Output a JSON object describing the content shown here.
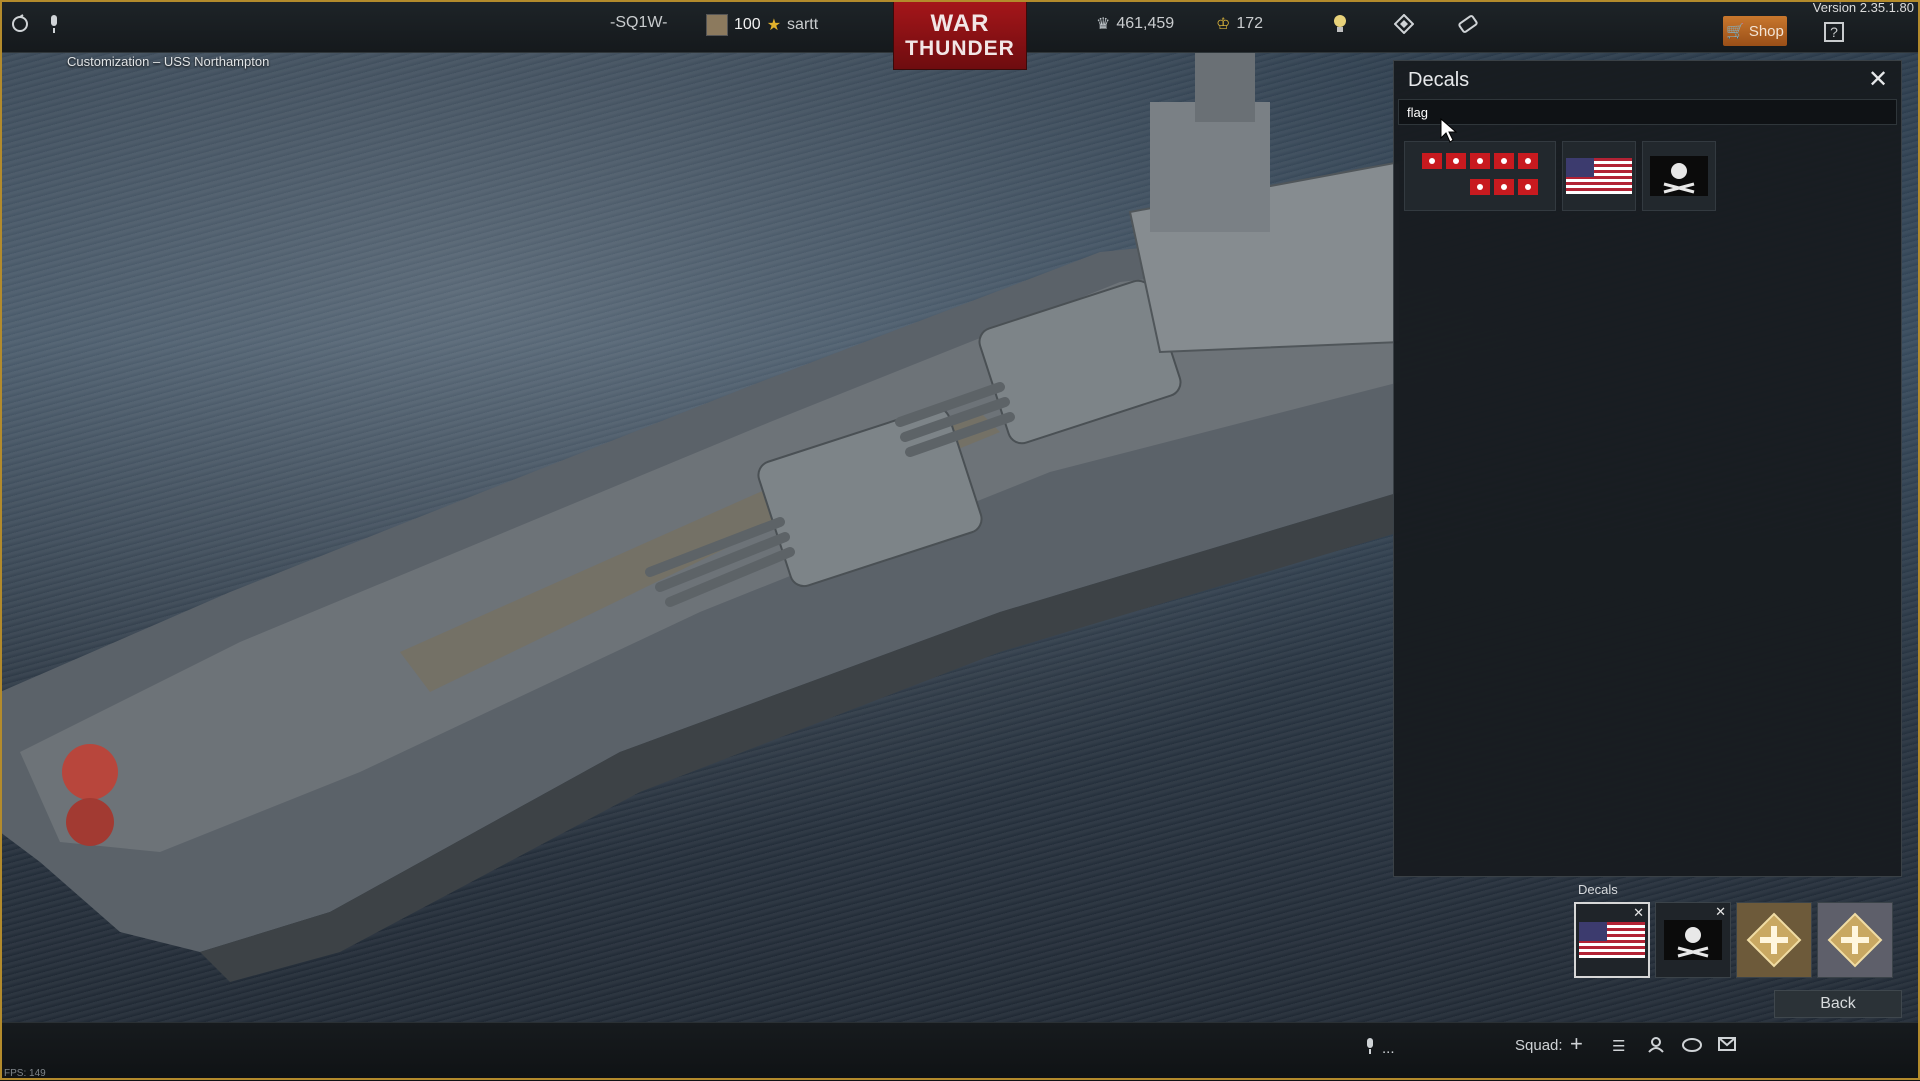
{
  "topbar": {
    "squad_tag": "-SQ1W-",
    "level": "100",
    "username": "sartt",
    "silver_lions": "461,459",
    "golden_eagles": "172",
    "logo_line1": "WAR",
    "logo_line2": "THUNDER",
    "shop_label": "Shop",
    "help_label": "?",
    "version": "Version 2.35.1.80"
  },
  "breadcrumb": "Customization – USS Northampton",
  "panel": {
    "title": "Decals",
    "search_value": "flag",
    "close_icon": "close-icon",
    "results": [
      {
        "name": "decal-japanese-flags-set"
      },
      {
        "name": "decal-us-flag"
      },
      {
        "name": "decal-jolly-roger"
      }
    ]
  },
  "slots": {
    "label": "Decals",
    "items": [
      {
        "name": "us-flag",
        "removable": true
      },
      {
        "name": "jolly-roger",
        "removable": true
      },
      {
        "name": "empty-slot"
      },
      {
        "name": "empty-slot"
      }
    ]
  },
  "back_label": "Back",
  "bottombar": {
    "mic_suffix": "...",
    "squad_label": "Squad:"
  },
  "fps": "FPS: 149",
  "colors": {
    "frame": "#b38b2c",
    "shop": "#c8772d",
    "logo_red": "#a5161a"
  }
}
